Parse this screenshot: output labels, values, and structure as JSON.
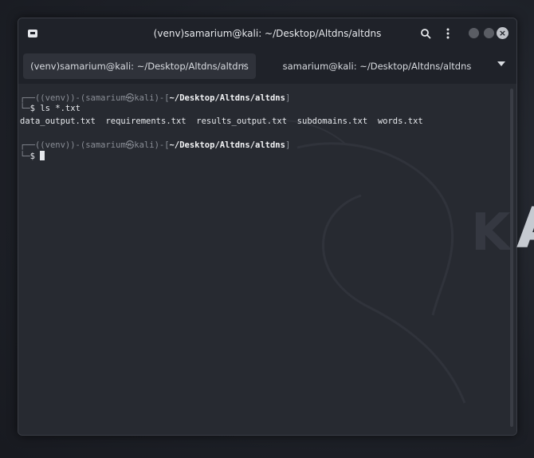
{
  "window": {
    "title": "(venv)samarium@kali: ~/Desktop/Altdns/altdns"
  },
  "tabs": [
    {
      "label": "(venv)samarium@kali: ~/Desktop/Altdns/altdns",
      "active": true
    },
    {
      "label": "samarium@kali: ~/Desktop/Altdns/altdns",
      "active": false
    }
  ],
  "terminal": {
    "prompt1": {
      "env": "(venv)",
      "user": "samarium",
      "at": "㉿",
      "host": "kali",
      "path": "~/Desktop/Altdns/altdns"
    },
    "command1": "ls *.txt",
    "output1": "data_output.txt  requirements.txt  results_output.txt  subdomains.txt  words.txt",
    "prompt2": {
      "env": "(venv)",
      "user": "samarium",
      "at": "㉿",
      "host": "kali",
      "path": "~/Desktop/Altdns/altdns"
    },
    "dollar": "$"
  },
  "icons": [
    "terminal-icon",
    "search-icon",
    "menu-dots-icon",
    "minimize-icon",
    "maximize-icon",
    "close-icon",
    "tab-close-icon",
    "tab-menu-icon"
  ],
  "colors": {
    "background": "#272a31",
    "titlebar": "#1f2229",
    "text": "#e6e8ec"
  }
}
